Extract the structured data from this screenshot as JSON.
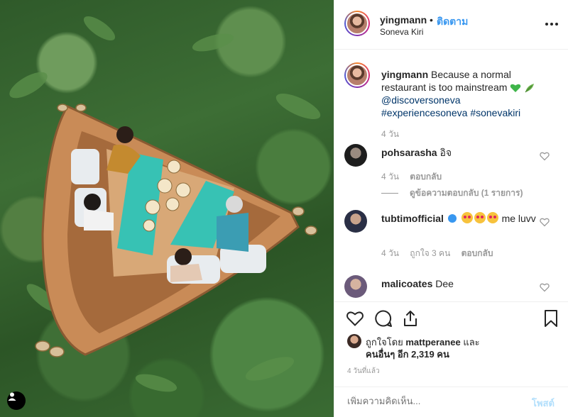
{
  "header": {
    "username": "yingmann",
    "separator": "•",
    "follow_label": "ติดตาม",
    "location": "Soneva Kiri",
    "more_icon": "more-horizontal-icon"
  },
  "caption": {
    "username": "yingmann",
    "text": "Because a normal restaurant is too mainstream",
    "mentions": "@discoversoneva",
    "hashtags": [
      "#experiencesoneva",
      "#sonevakiri"
    ],
    "time": "4 วัน"
  },
  "comments": [
    {
      "username": "pohsarasha",
      "text": "อิจ",
      "time": "4 วัน",
      "reply_label": "ตอบกลับ",
      "view_replies": "ดูข้อความตอบกลับ (1 รายการ)"
    },
    {
      "username": "tubtimofficial",
      "text": "me luvv",
      "time": "4 วัน",
      "likes": "ถูกใจ 3 คน",
      "reply_label": "ตอบกลับ"
    },
    {
      "username": "malicoates",
      "text": "Dee"
    }
  ],
  "likes": {
    "prefix": "ถูกใจโดย",
    "liker": "mattperanee",
    "and": "และ",
    "others_label": "คนอื่นๆ อีก 2,319 คน"
  },
  "timestamp": "4 วันที่แล้ว",
  "comment_box": {
    "placeholder": "เพิ่มความคิดเห็น...",
    "post_label": "โพสต์"
  },
  "colors": {
    "link_blue": "#3897f0",
    "mention_navy": "#003569",
    "muted": "#999999",
    "post_disabled": "#b2dffc"
  }
}
